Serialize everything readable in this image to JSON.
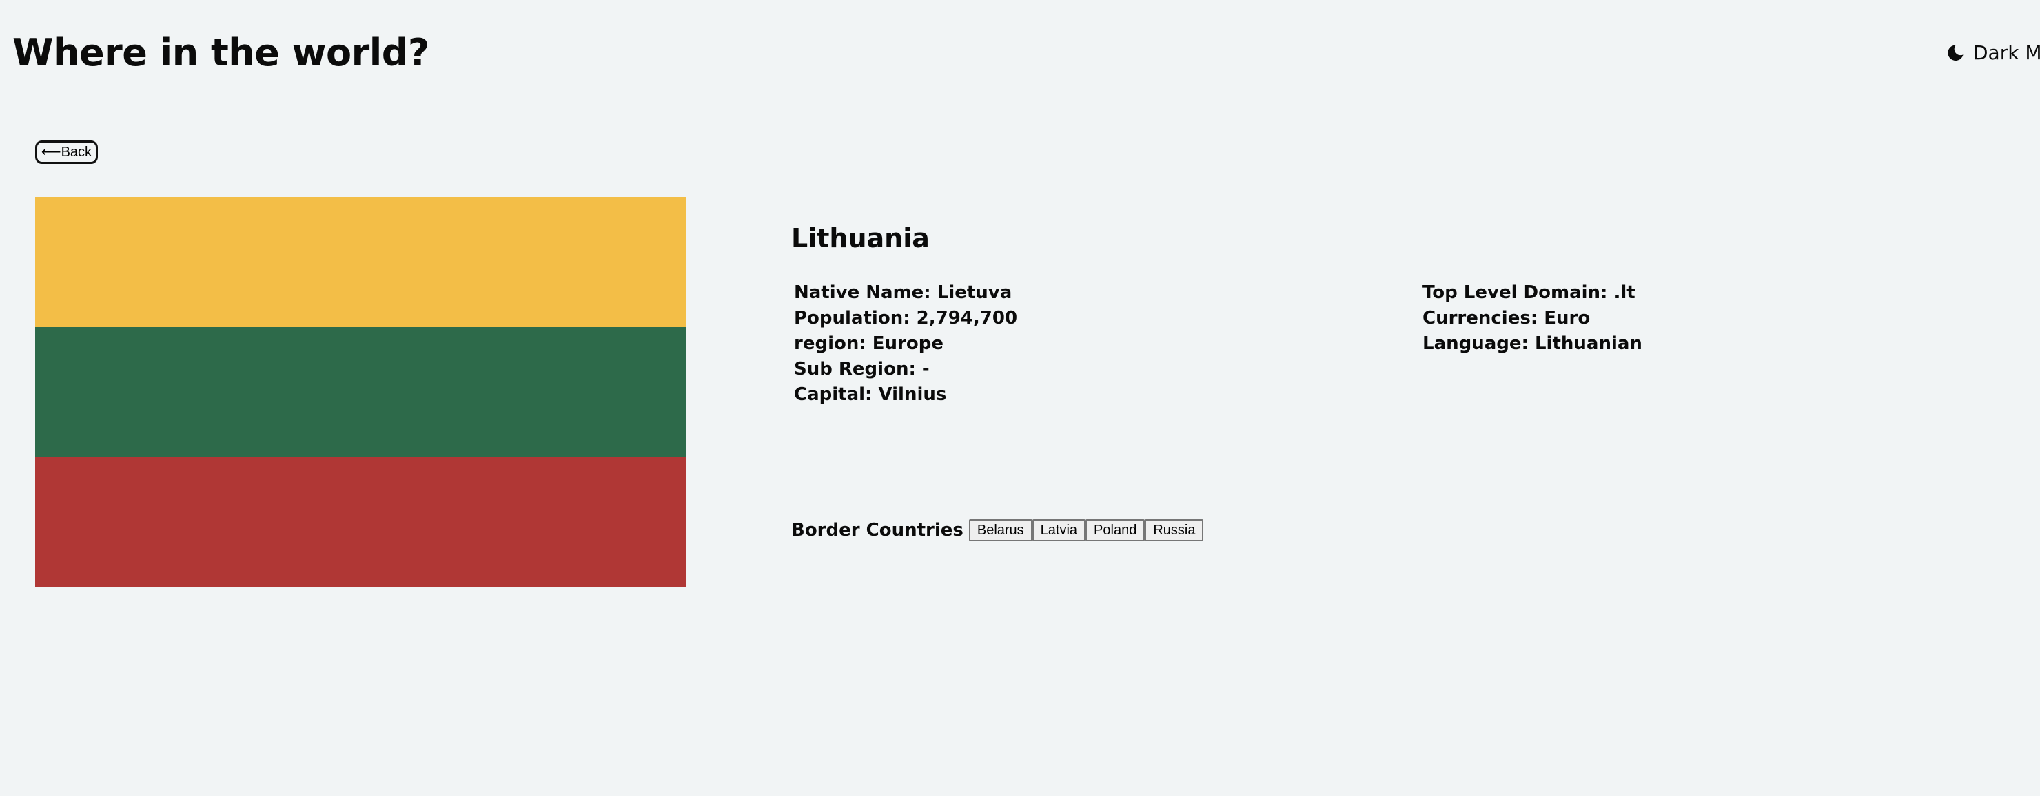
{
  "header": {
    "title": "Where in the world?",
    "theme_toggle": {
      "icon": "moon-icon",
      "label": "Dark Mode"
    }
  },
  "nav": {
    "back_label": "⟵Back"
  },
  "country": {
    "name": "Lithuania",
    "flag": {
      "bands": [
        "#f3be47",
        "#2d6a4a",
        "#b03735"
      ]
    },
    "details_left": [
      "Native Name: Lietuva",
      "Population: 2,794,700",
      "region: Europe",
      "Sub Region: -",
      "Capital: Vilnius"
    ],
    "details_right": [
      "Top Level Domain: .lt",
      "Currencies: Euro",
      "Language: Lithuanian"
    ],
    "borders": {
      "label": "Border Countries",
      "countries": [
        "Belarus",
        "Latvia",
        "Poland",
        "Russia"
      ]
    }
  },
  "colors": {
    "background": "#f1f4f5",
    "text": "#0b0b0b"
  }
}
